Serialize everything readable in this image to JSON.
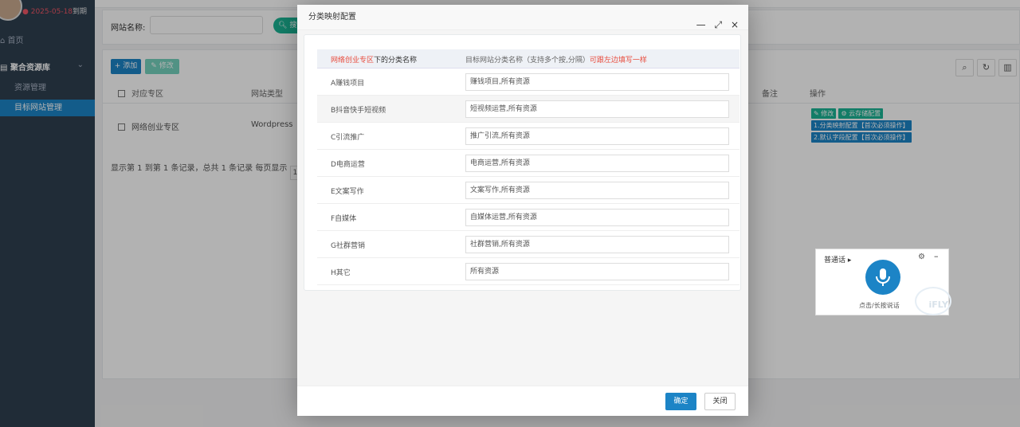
{
  "sidebar": {
    "expiry_date": "2025-05-18",
    "expiry_suffix": "到期",
    "home": "首页",
    "group": "聚合资源库",
    "items": [
      {
        "label": "资源管理"
      },
      {
        "label": "目标网站管理"
      }
    ]
  },
  "search": {
    "label": "网站名称:",
    "button": "搜索"
  },
  "toolbar": {
    "add": "+ 添加",
    "edit": "修改"
  },
  "table": {
    "headers": [
      "对应专区",
      "网站类型",
      "备注",
      "操作"
    ],
    "row": {
      "zone": "网络创业专区",
      "type": "Wordpress",
      "actions": [
        "修改",
        "云存储配置",
        "1.分类映射配置【首次必须操作】",
        "2.默认字段配置【首次必须操作】"
      ]
    },
    "pager": "显示第 1 到第 1 条记录，总共 1 条记录  每页显示",
    "page_size": "1"
  },
  "modal": {
    "title": "分类映射配置",
    "head_left_red": "网络创业专区",
    "head_left": "下的分类名称",
    "head_right": "目标网站分类名称（支持多个按,分隔）",
    "head_right_red": "可跟左边填写一样",
    "rows": [
      {
        "label": "A赚钱项目",
        "value": "赚钱项目,所有资源"
      },
      {
        "label": "B抖音快手短视频",
        "value": "短视频运营,所有资源"
      },
      {
        "label": "C引流推广",
        "value": "推广引流,所有资源"
      },
      {
        "label": "D电商运营",
        "value": "电商运营,所有资源"
      },
      {
        "label": "E文案写作",
        "value": "文案写作,所有资源"
      },
      {
        "label": "F自媒体",
        "value": "自媒体运营,所有资源"
      },
      {
        "label": "G社群营销",
        "value": "社群营销,所有资源"
      },
      {
        "label": "H其它",
        "value": "所有资源"
      }
    ],
    "ok": "确定",
    "close": "关闭"
  },
  "voice": {
    "lang": "普通话",
    "hint": "点击/长按说话",
    "logo": "iFLY"
  },
  "colors": {
    "primary": "#1c84c6",
    "success": "#1ab394",
    "sidebar": "#2f4050",
    "accent_red": "#e84c3d"
  }
}
